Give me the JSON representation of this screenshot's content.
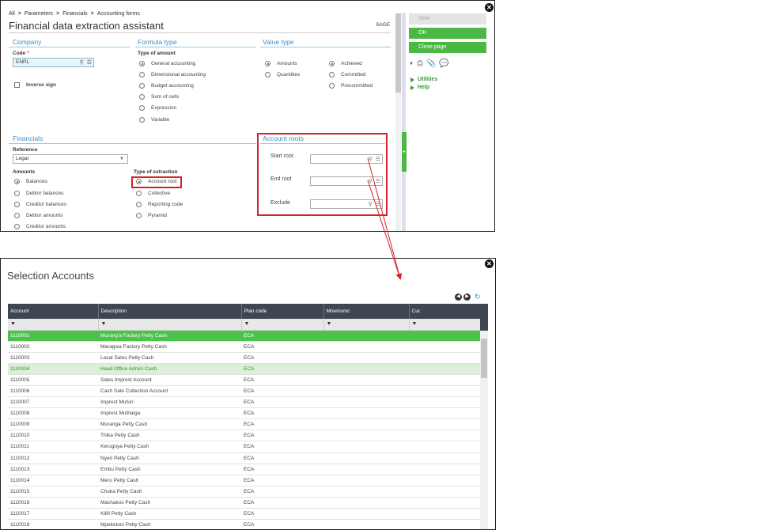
{
  "top_window": {
    "breadcrumb": [
      "All",
      "Parameters",
      "Financials",
      "Accounting forms"
    ],
    "breadcrumb_separator": ">",
    "title": "Financial data extraction assistant",
    "sage_label": "SAGE",
    "company": {
      "section_title": "Company",
      "code_label": "Code",
      "required_marker": "*",
      "code_value": "ENPL",
      "inverse_sign_label": "Inverse sign"
    },
    "formula_type": {
      "section_title": "Formula type",
      "type_of_amount_label": "Type of amount",
      "options": [
        {
          "label": "General accounting",
          "checked": true
        },
        {
          "label": "Dimensional accounting",
          "checked": false
        },
        {
          "label": "Budget accounting",
          "checked": false
        },
        {
          "label": "Sum of cells",
          "checked": false
        },
        {
          "label": "Expression",
          "checked": false
        },
        {
          "label": "Variable",
          "checked": false
        }
      ]
    },
    "value_type": {
      "section_title": "Value type",
      "col1": [
        {
          "label": "Amounts",
          "checked": true
        },
        {
          "label": "Quantities",
          "checked": false
        }
      ],
      "col2": [
        {
          "label": "Achieved",
          "checked": true
        },
        {
          "label": "Committed",
          "checked": false
        },
        {
          "label": "Precommitted",
          "checked": false
        }
      ]
    },
    "financials": {
      "section_title": "Financials",
      "reference_label": "Reference",
      "reference_value": "Legal",
      "amounts_label": "Amounts",
      "amounts": [
        {
          "label": "Balances",
          "checked": true
        },
        {
          "label": "Debtor balances",
          "checked": false
        },
        {
          "label": "Creditor balances",
          "checked": false
        },
        {
          "label": "Debtor amounts",
          "checked": false
        },
        {
          "label": "Creditor amounts",
          "checked": false
        }
      ],
      "extraction_label": "Type of extraction",
      "extraction": [
        {
          "label": "Account root",
          "checked": true
        },
        {
          "label": "Collective",
          "checked": false
        },
        {
          "label": "Reporting code",
          "checked": false
        },
        {
          "label": "Pyramid",
          "checked": false
        }
      ]
    },
    "account_roots": {
      "section_title": "Account roots",
      "start_label": "Start root",
      "end_label": "End root",
      "exclude_label": "Exclude"
    },
    "actions": {
      "new_label": "New",
      "ok_label": "OK",
      "close_page_label": "Close page",
      "utilities_label": "Utilities",
      "help_label": "Help"
    },
    "icons": {
      "search": "search-icon",
      "list": "list-icon",
      "print": "print-icon",
      "attach": "paperclip-icon",
      "comment": "comment-icon",
      "close": "close-icon"
    },
    "colors": {
      "accent_green": "#4bb843",
      "section_blue": "#3a8ec4",
      "highlight_red": "#d6202a"
    }
  },
  "bottom_window": {
    "title": "Selection Accounts",
    "columns": [
      "Account",
      "Description",
      "Plan code",
      "Mnemonic",
      "Cur."
    ],
    "rows": [
      {
        "account": "1110001",
        "description": "Murang'a Factory Petty Cash",
        "plan": "ECA",
        "state": "selected"
      },
      {
        "account": "1110002",
        "description": "Maragwa Factory Petty Cash",
        "plan": "ECA",
        "state": ""
      },
      {
        "account": "1110003",
        "description": "Local Sales Petty Cash",
        "plan": "ECA",
        "state": ""
      },
      {
        "account": "1110004",
        "description": "Head Office Admin Cash",
        "plan": "ECA",
        "state": "highlight"
      },
      {
        "account": "1110005",
        "description": "Sales Imprest Account",
        "plan": "ECA",
        "state": ""
      },
      {
        "account": "1110006",
        "description": "Cash Sale Collection Account",
        "plan": "ECA",
        "state": ""
      },
      {
        "account": "1110007",
        "description": "Imprest Muturi",
        "plan": "ECA",
        "state": ""
      },
      {
        "account": "1110008",
        "description": "Imprest Muthaiga",
        "plan": "ECA",
        "state": ""
      },
      {
        "account": "1110009",
        "description": "Muranga Petty Cash",
        "plan": "ECA",
        "state": ""
      },
      {
        "account": "1110010",
        "description": "Thika Petty Cash",
        "plan": "ECA",
        "state": ""
      },
      {
        "account": "1110011",
        "description": "Kerugoya Petty Cash",
        "plan": "ECA",
        "state": ""
      },
      {
        "account": "1110012",
        "description": "Nyeri Petty Cash",
        "plan": "ECA",
        "state": ""
      },
      {
        "account": "1110013",
        "description": "Embu Petty Cash",
        "plan": "ECA",
        "state": ""
      },
      {
        "account": "1110014",
        "description": "Meru Petty Cash",
        "plan": "ECA",
        "state": ""
      },
      {
        "account": "1110015",
        "description": "Chuka Petty Cash",
        "plan": "ECA",
        "state": ""
      },
      {
        "account": "1110016",
        "description": "Machakos Petty Cash",
        "plan": "ECA",
        "state": ""
      },
      {
        "account": "1110017",
        "description": "Kilifi Petty Cash",
        "plan": "ECA",
        "state": ""
      },
      {
        "account": "1110018",
        "description": "Mpeketoni Petty Cash",
        "plan": "ECA",
        "state": ""
      }
    ],
    "icons": {
      "filter": "filter-icon",
      "prev": "chevron-left-icon",
      "next": "chevron-right-icon",
      "refresh": "refresh-icon"
    }
  }
}
